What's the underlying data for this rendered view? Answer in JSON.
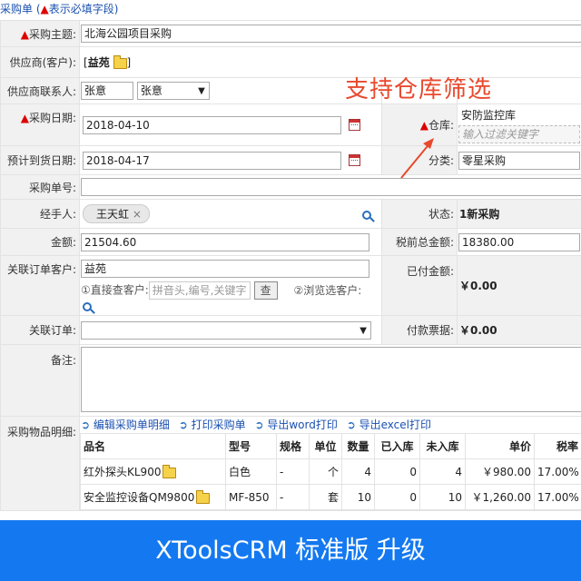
{
  "header": {
    "title": "采购单",
    "note_open": " (",
    "note_mark": "▲",
    "note_text": "表示必填字段",
    "note_close": ")"
  },
  "form": {
    "subject": {
      "label": "采购主题:",
      "value": "北海公园项目采购"
    },
    "supplier": {
      "label": "供应商(客户):",
      "value": "益苑"
    },
    "contact": {
      "label": "供应商联系人:",
      "value": "张意",
      "select": "张意"
    },
    "purchase_date": {
      "label": "采购日期:",
      "value": "2018-04-10"
    },
    "warehouse": {
      "label": "仓库:",
      "value": "安防监控库",
      "filter_placeholder": "输入过滤关键字"
    },
    "arrival_date": {
      "label": "预计到货日期:",
      "value": "2018-04-17"
    },
    "category": {
      "label": "分类:",
      "value": "零星采购"
    },
    "order_no": {
      "label": "采购单号:",
      "value": ""
    },
    "handler": {
      "label": "经手人:",
      "value": "王天虹"
    },
    "status": {
      "label": "状态:",
      "value": "1新采购"
    },
    "amount": {
      "label": "金额:",
      "value": "21504.60"
    },
    "pretax": {
      "label": "税前总金额:",
      "value": "18380.00"
    },
    "related_customer": {
      "label": "关联订单客户:",
      "value": "益苑",
      "direct_label": "①直接查客户:",
      "search_placeholder": "拼音头,编号,关键字",
      "search_btn": "查",
      "browse_label": "②浏览选客户:"
    },
    "paid": {
      "label": "已付金额:",
      "value": "￥0.00"
    },
    "related_order": {
      "label": "关联订单:",
      "value": ""
    },
    "invoice": {
      "label": "付款票据:",
      "value": "￥0.00"
    },
    "remark": {
      "label": "备注:",
      "value": ""
    },
    "items": {
      "label": "采购物品明细:"
    }
  },
  "actions": [
    "编辑采购单明细",
    "打印采购单",
    "导出word打印",
    "导出excel打印"
  ],
  "table": {
    "headers": [
      "品名",
      "型号",
      "规格",
      "单位",
      "数量",
      "已入库",
      "未入库",
      "单价",
      "税率"
    ],
    "rows": [
      [
        "红外探头KL900",
        "白色",
        "-",
        "个",
        "4",
        "0",
        "4",
        "￥980.00",
        "17.00%"
      ],
      [
        "安全监控设备QM9800",
        "MF-850",
        "-",
        "套",
        "10",
        "0",
        "10",
        "￥1,260.00",
        "17.00%"
      ]
    ]
  },
  "annotation": "支持仓库筛选",
  "banner": "XToolsCRM 标准版  升级",
  "colors": {
    "required": "#dd0000",
    "link": "#1a50b0",
    "annotation": "#e8492d",
    "banner": "#1479f0"
  }
}
